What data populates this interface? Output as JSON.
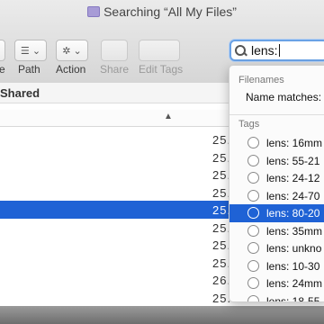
{
  "window": {
    "title": "Searching “All My Files”"
  },
  "toolbar": {
    "labels": [
      "e",
      "Path",
      "Action",
      "Share",
      "Edit Tags"
    ],
    "search_value": "lens:"
  },
  "columns": {
    "shared": "Shared"
  },
  "rows": [
    "25.",
    "25.",
    "25.",
    "25.",
    "25.",
    "25.",
    "25.",
    "25.",
    "26.",
    "25."
  ],
  "popup": {
    "filenames_title": "Filenames",
    "name_matches": "Name matches:",
    "tags_title": "Tags",
    "tags": [
      "lens: 16mm",
      "lens: 55-21",
      "lens: 24-12",
      "lens: 24-70",
      "lens: 80-20",
      "lens: 35mm",
      "lens: unkno",
      "lens: 10-30",
      "lens: 24mm",
      "lens: 18-55"
    ],
    "selected_index": 4
  },
  "colors": {
    "accent": "#1f62d5",
    "search_focus": "#6aa2e6"
  }
}
